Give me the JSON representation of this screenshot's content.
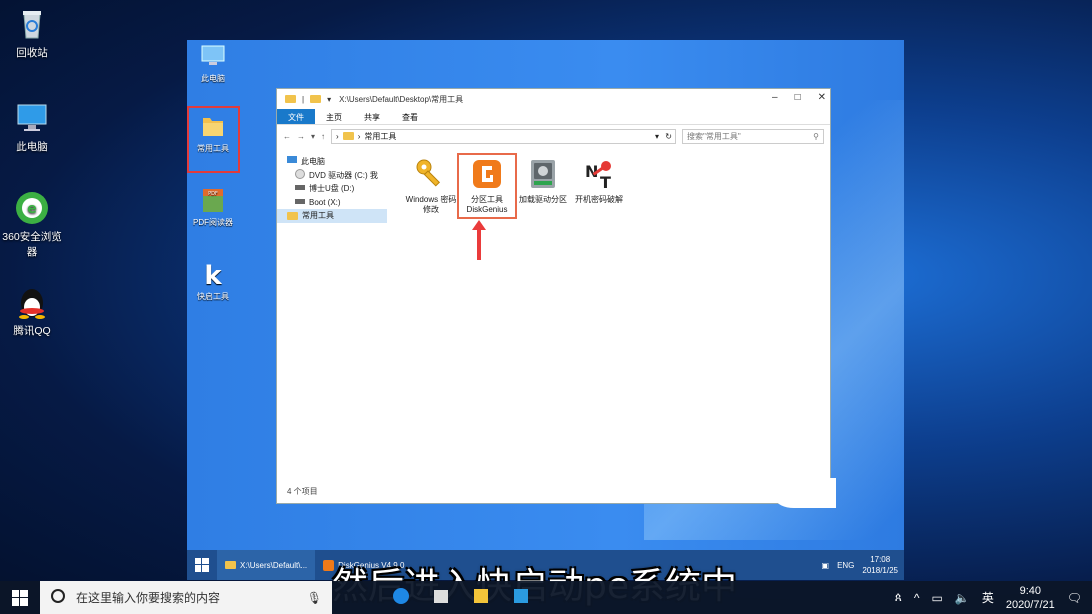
{
  "host_desktop": {
    "icons": [
      {
        "label": "回收站",
        "icon": "recycle-bin-icon"
      },
      {
        "label": "此电脑",
        "icon": "computer-icon"
      },
      {
        "label": "360安全浏览器",
        "icon": "browser-360-icon"
      },
      {
        "label": "腾讯QQ",
        "icon": "qq-icon"
      }
    ]
  },
  "vm_desktop": {
    "icons": [
      {
        "label": "此电脑",
        "icon": "computer-icon"
      },
      {
        "label": "常用工具",
        "icon": "folder-icon"
      },
      {
        "label": "PDF阅读器",
        "icon": "pdf-icon"
      },
      {
        "label": "快启工具",
        "icon": "k-app-icon"
      }
    ]
  },
  "explorer": {
    "title": "X:\\Users\\Default\\Desktop\\常用工具",
    "ribbon_tabs": [
      "文件",
      "主页",
      "共享",
      "查看"
    ],
    "address": "常用工具",
    "search_placeholder": "搜索\"常用工具\"",
    "nav_items": [
      {
        "label": "此电脑",
        "icon": "computer-icon"
      },
      {
        "label": "DVD 驱动器 (C:) 我",
        "icon": "dvd-icon"
      },
      {
        "label": "博士U盘 (D:)",
        "icon": "drive-icon"
      },
      {
        "label": "Boot (X:)",
        "icon": "drive-icon"
      },
      {
        "label": "常用工具",
        "icon": "folder-icon"
      }
    ],
    "files": [
      {
        "label": "Windows 密码修改",
        "icon": "key-icon"
      },
      {
        "label": "分区工具 DiskGenius",
        "icon": "diskgenius-icon"
      },
      {
        "label": "加载驱动分区",
        "icon": "hdd-icon"
      },
      {
        "label": "开机密码破解",
        "icon": "nt-key-icon"
      }
    ],
    "status": "4 个项目"
  },
  "vm_taskbar": {
    "buttons": [
      "X:\\Users\\Default\\...",
      "DiskGenius V4.9.0"
    ],
    "lang": "ENG",
    "time": "17:08",
    "date": "2018/1/25"
  },
  "subtitle": "然后进入快启动pe系统中",
  "host_taskbar": {
    "search_placeholder": "在这里输入你要搜索的内容",
    "ime": "英",
    "time": "9:40",
    "date": "2020/7/21"
  },
  "colors": {
    "accent": "#1979ca",
    "highlight_red": "#e23b3b",
    "vm_background": "#3586e8"
  }
}
